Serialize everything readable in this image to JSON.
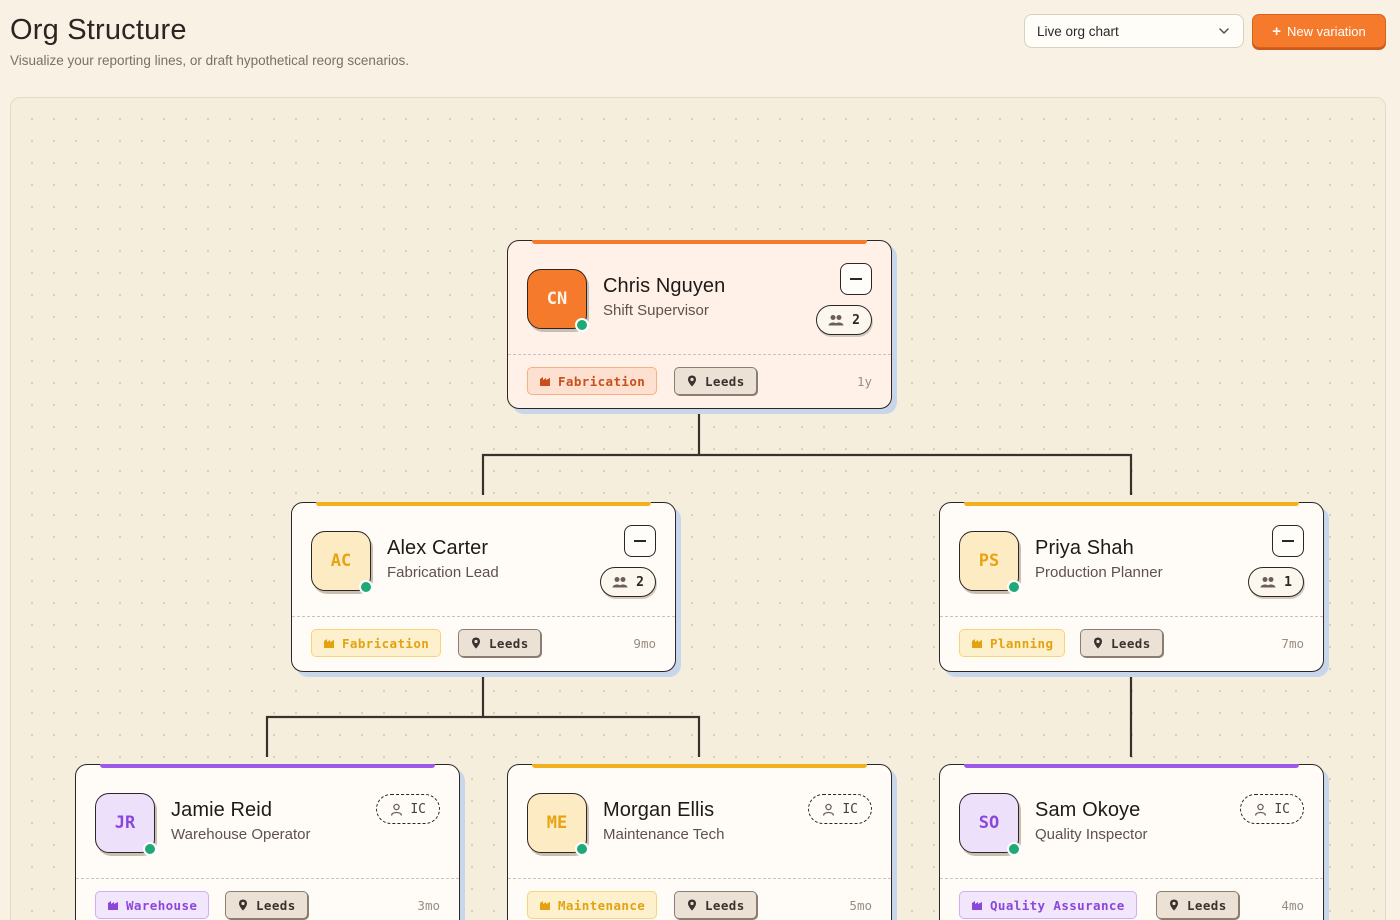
{
  "header": {
    "title": "Org Structure",
    "subtitle": "Visualize your reporting lines, or draft hypothetical reorg scenarios."
  },
  "toolbar": {
    "view_select": "Live org chart",
    "new_button": "New variation"
  },
  "nodes": [
    {
      "initials": "CN",
      "name": "Chris Nguyen",
      "role": "Shift Supervisor",
      "reports": "2",
      "department": "Fabrication",
      "location": "Leeds",
      "tenure": "1y",
      "accent": "#f57a2c"
    },
    {
      "initials": "AC",
      "name": "Alex Carter",
      "role": "Fabrication Lead",
      "reports": "2",
      "department": "Fabrication",
      "location": "Leeds",
      "tenure": "9mo",
      "accent": "#f2b01e"
    },
    {
      "initials": "PS",
      "name": "Priya Shah",
      "role": "Production Planner",
      "reports": "1",
      "department": "Planning",
      "location": "Leeds",
      "tenure": "7mo",
      "accent": "#f2b01e"
    },
    {
      "initials": "JR",
      "name": "Jamie Reid",
      "role": "Warehouse Operator",
      "badge": "IC",
      "department": "Warehouse",
      "location": "Leeds",
      "tenure": "3mo",
      "accent": "#9b59e6"
    },
    {
      "initials": "ME",
      "name": "Morgan Ellis",
      "role": "Maintenance Tech",
      "badge": "IC",
      "department": "Maintenance",
      "location": "Leeds",
      "tenure": "5mo",
      "accent": "#f2b01e"
    },
    {
      "initials": "SO",
      "name": "Sam Okoye",
      "role": "Quality Inspector",
      "badge": "IC",
      "department": "Quality Assurance",
      "location": "Leeds",
      "tenure": "4mo",
      "accent": "#9b59e6"
    }
  ]
}
